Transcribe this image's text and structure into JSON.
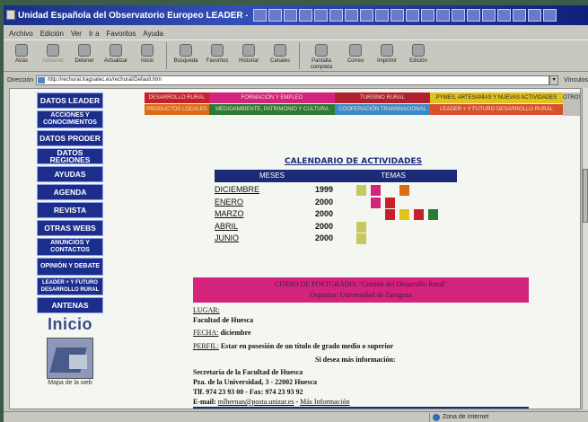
{
  "window": {
    "title": "Unidad Española del Observatorio Europeo LEADER - Microsoft Internet Explorer"
  },
  "menu": [
    "Archivo",
    "Edición",
    "Ver",
    "Ir a",
    "Favoritos",
    "Ayuda"
  ],
  "toolbar": [
    {
      "label": "Atrás",
      "icon": "back-arrow-icon",
      "enabled": true
    },
    {
      "label": "Adelante",
      "icon": "forward-arrow-icon",
      "enabled": false
    },
    {
      "label": "Detener",
      "icon": "stop-icon",
      "enabled": true
    },
    {
      "label": "Actualizar",
      "icon": "refresh-icon",
      "enabled": true
    },
    {
      "label": "Inicio",
      "icon": "home-icon",
      "enabled": true
    },
    {
      "label": "Búsqueda",
      "icon": "search-icon",
      "enabled": true
    },
    {
      "label": "Favoritos",
      "icon": "favorites-icon",
      "enabled": true
    },
    {
      "label": "Historial",
      "icon": "history-icon",
      "enabled": true
    },
    {
      "label": "Canales",
      "icon": "channels-icon",
      "enabled": true
    },
    {
      "label": "Pantalla completa",
      "icon": "fullscreen-icon",
      "enabled": true
    },
    {
      "label": "Correo",
      "icon": "mail-icon",
      "enabled": true
    },
    {
      "label": "Imprimir",
      "icon": "print-icon",
      "enabled": true
    },
    {
      "label": "Edición",
      "icon": "edit-icon",
      "enabled": true
    }
  ],
  "address": {
    "label": "Dirección",
    "url": "http://rechural.tragsatec.es/rechural/Default.htm",
    "links": "Vínculos"
  },
  "status": {
    "zone": "Zona de Internet"
  },
  "nav": [
    "DATOS LEADER",
    "ACCIONES Y CONOCIMIENTOS",
    "DATOS PRODER",
    "DATOS REGIONES",
    "AYUDAS",
    "AGENDA",
    "REVISTA",
    "OTRAS WEBS",
    "ANUNCIOS Y CONTACTOS",
    "OPINIÓN Y DEBATE",
    "LEADER + Y FUTURO DESARROLLO RURAL",
    "ANTENAS"
  ],
  "inicio_label": "Inicio",
  "map_label": "Mapa de la web",
  "categories": [
    {
      "label": "DESARROLLO RURAL",
      "color": "#c8202a"
    },
    {
      "label": "FORMACIÓN Y EMPLEO",
      "color": "#d3237c"
    },
    {
      "label": "TURISMO RURAL",
      "color": "#b0202e"
    },
    {
      "label": "PYMES, ARTESANÍAS Y NUEVAS ACTIVIDADES",
      "color": "#e0c21c"
    },
    {
      "label": "PRODUCTOS LOCALES",
      "color": "#dc6a14"
    },
    {
      "label": "MEDIOAMBIENTE, PATRIMONIO Y CULTURA",
      "color": "#2c7a34"
    },
    {
      "label": "COOPERACIÓN TRANSNACIONAL",
      "color": "#3c8ac8"
    },
    {
      "label": "LEADER + Y FUTURO DESARROLLO RURAL",
      "color": "#d8502a"
    },
    {
      "label": "OTROS",
      "color": "#c0c0b8"
    }
  ],
  "calendar": {
    "title": "CALENDARIO DE ACTIVIDADES",
    "col_months": "MESES",
    "col_topics": "TEMAS",
    "rows": [
      {
        "month": "DICIEMBRE",
        "year": "1999",
        "topics": [
          "#c8c860",
          "#d3237c",
          null,
          "#dc6a14"
        ]
      },
      {
        "month": "ENERO",
        "year": "2000",
        "topics": [
          null,
          "#d3237c",
          "#c8202a",
          null
        ]
      },
      {
        "month": "MARZO",
        "year": "2000",
        "topics": [
          null,
          null,
          "#c8202a",
          "#e0c21c",
          "#c8202a",
          "#2c7a34"
        ]
      },
      {
        "month": "ABRIL",
        "year": "2000",
        "topics": [
          "#c8c860"
        ]
      },
      {
        "month": "JUNIO",
        "year": "2000",
        "topics": [
          "#c8c860"
        ]
      }
    ]
  },
  "course": {
    "line1": "CURSO DE POSTGRADO: \"Gestión del Desarrollo Rural\"",
    "line2": "Organiza: Universidad de Zaragoza"
  },
  "details": {
    "lugar_label": "LUGAR:",
    "lugar_value": "Facultad de Huesca",
    "fecha_label": "FECHA:",
    "fecha_value": " diciembre",
    "perfil_label": "PERFIL:",
    "perfil_value": " Estar en posesión de un título de grado medio o superior",
    "more_info": "Si desea más información:",
    "addr1": "Secretaría de la Facultad de Huesca",
    "addr2": "Pza. de la Universidad, 3 - 22002 Huesca",
    "addr3": "Tlf. 974 23 93 00 - Fax: 974 23 93 92",
    "email_label": "E-mail: ",
    "email": "mlhernan@posta.unizar.es",
    "email_sep": " - ",
    "more_link": "Más Información"
  }
}
